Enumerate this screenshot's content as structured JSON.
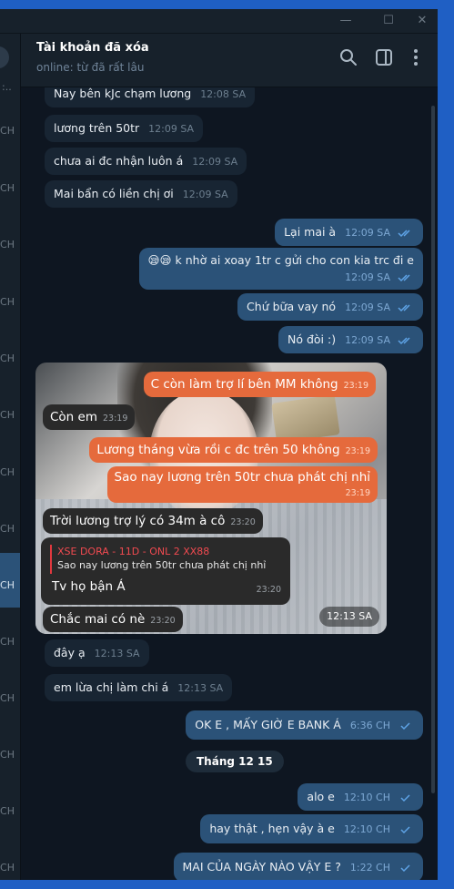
{
  "window": {
    "controls": {
      "minimize": "—",
      "maximize": "☐",
      "close": "✕"
    }
  },
  "sidebar": {
    "times": [
      "CH",
      "CH",
      "CH",
      "CH",
      "CH",
      "CH",
      "CH",
      "CH",
      "CH",
      "CH",
      "CH",
      "CH",
      "CH",
      "CH",
      "CH",
      "CH"
    ]
  },
  "header": {
    "title": "Tài khoản đã xóa",
    "status": "online: từ đã rất lâu"
  },
  "messages": [
    {
      "text": "Nay bên kJc chạm lương",
      "time": "12:08 SA"
    },
    {
      "text": "lương trên 50tr",
      "time": "12:09 SA"
    },
    {
      "text": "chưa ai đc nhận luôn á",
      "time": "12:09 SA"
    },
    {
      "text": "Mai bẩn có liền chị ơi",
      "time": "12:09 SA"
    },
    {
      "text": "Lại mai à",
      "time": "12:09 SA"
    },
    {
      "text": "😪😪 k nhờ ai xoay 1tr c gửi cho con kia trc đi e",
      "time": "12:09 SA"
    },
    {
      "text": "Chứ bữa vay nó",
      "time": "12:09 SA"
    },
    {
      "text": "Nó đòi :)",
      "time": "12:09 SA"
    },
    {
      "text": "đây ạ",
      "time": "12:13 SA"
    },
    {
      "text": "em lừa chị làm chi á",
      "time": "12:13 SA"
    },
    {
      "text": "OK E , MẤY GIỜ E BANK Á",
      "time": "6:36 CH"
    },
    {
      "text": "alo e",
      "time": "12:10 CH"
    },
    {
      "text": "hay thật , hẹn vậy à e",
      "time": "12:10 CH"
    },
    {
      "text": "MAI CỦA NGÀY NÀO VẬY E ?",
      "time": "1:22 CH"
    }
  ],
  "date_separator": "Tháng 12 15",
  "photo": {
    "time": "12:13 SA",
    "bubbles": [
      {
        "text": "C còn làm trợ lí bên MM không",
        "time": "23:19"
      },
      {
        "text": "Còn em",
        "time": "23:19"
      },
      {
        "text": "Lương tháng vừa rồi c đc trên 50 không",
        "time": "23:19"
      },
      {
        "text": "Sao nay lương trên 50tr chưa phát chị nhỉ",
        "time": "23:19"
      },
      {
        "text": "Trời lương trợ lý có 34m à cô",
        "time": "23:20"
      },
      {
        "text": "Tv họ bận Á",
        "time": "23:20"
      },
      {
        "text": "Chắc mai có nè",
        "time": "23:20"
      }
    ],
    "reply": {
      "name": "XSE DORA - 11D - ONL 2 XX88",
      "quote": "Sao nay lương trên 50tr chưa phát chị nhỉ"
    }
  },
  "colors": {
    "bg": "#0e1621",
    "incoming": "#182533",
    "outgoing": "#2b5278",
    "accent": "#5ea3e6",
    "orange": "#e56a3c"
  }
}
